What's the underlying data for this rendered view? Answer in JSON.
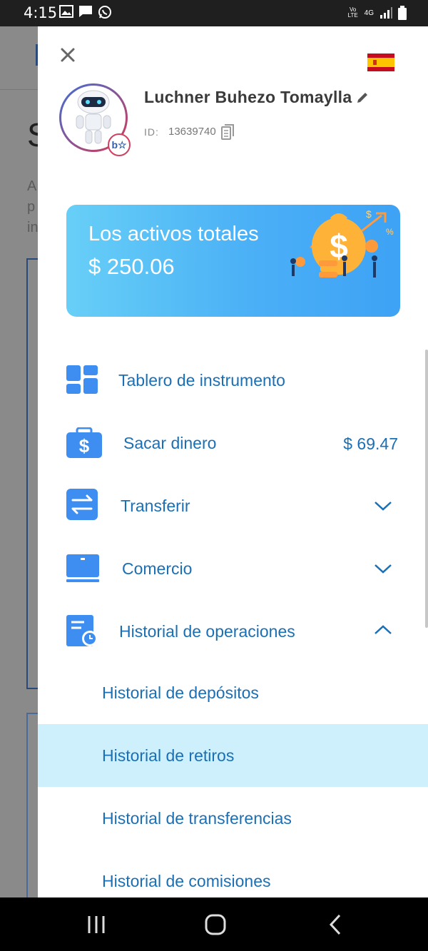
{
  "status_bar": {
    "time": "4:15",
    "network": "4G",
    "carrier_badge": "Vo LTE"
  },
  "background_page": {
    "title_fragment": "S",
    "text_fragments": [
      "A",
      "p",
      "in"
    ]
  },
  "drawer": {
    "language_flag": "spain-flag-icon",
    "profile": {
      "name": "Luchner Buhezo Tomaylla",
      "id_label": "ID:",
      "id_value": "13639740"
    },
    "assets_card": {
      "label": "Los activos totales",
      "amount": "$ 250.06"
    },
    "menu": {
      "dashboard": {
        "label": "Tablero de instrumento",
        "icon": "dashboard-icon"
      },
      "withdraw": {
        "label": "Sacar dinero",
        "value": "$ 69.47",
        "icon": "wallet-dollar-icon"
      },
      "transfer": {
        "label": "Transferir",
        "icon": "transfer-arrows-icon",
        "expanded": false
      },
      "trade": {
        "label": "Comercio",
        "icon": "laptop-icon",
        "expanded": false
      },
      "history": {
        "label": "Historial de operaciones",
        "icon": "history-clock-icon",
        "expanded": true,
        "items": [
          {
            "label": "Historial de depósitos",
            "active": false
          },
          {
            "label": "Historial de retiros",
            "active": true
          },
          {
            "label": "Historial de transferencias",
            "active": false
          },
          {
            "label": "Historial de comisiones",
            "active": false
          }
        ]
      }
    }
  },
  "colors": {
    "accent": "#1a6fb5",
    "icon_blue": "#3d8ef0",
    "active_row": "#cdf0fc",
    "card_start": "#67cff7",
    "card_end": "#3ea2f5"
  }
}
